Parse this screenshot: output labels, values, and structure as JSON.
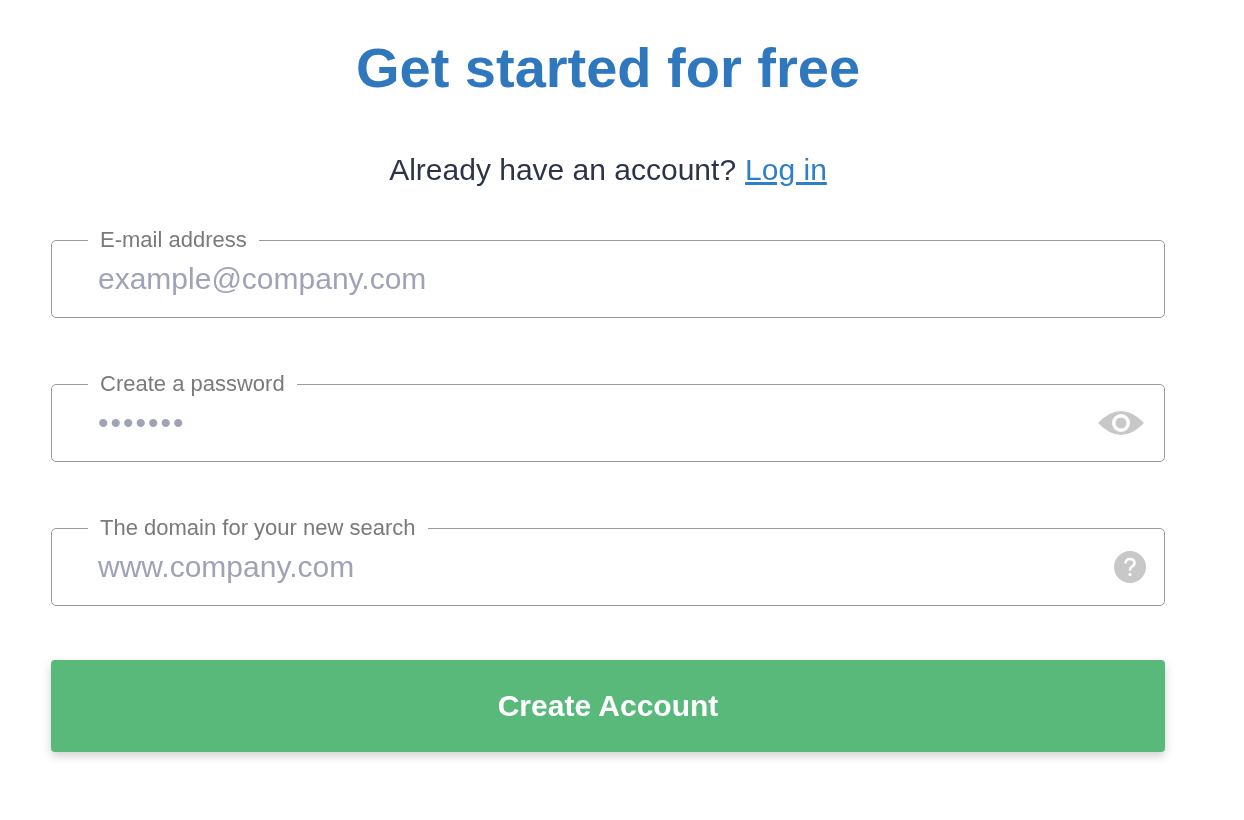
{
  "title": "Get started for free",
  "login_prompt": {
    "text": "Already have an account?",
    "link": "Log in"
  },
  "fields": [
    {
      "kind": "text",
      "label": "E-mail address",
      "placeholder": "example@company.com"
    },
    {
      "kind": "password",
      "label": "Create a password",
      "value": "•••••••"
    },
    {
      "kind": "help",
      "label": "The domain for your new search",
      "placeholder": "www.company.com"
    }
  ],
  "submit": "Create Account"
}
